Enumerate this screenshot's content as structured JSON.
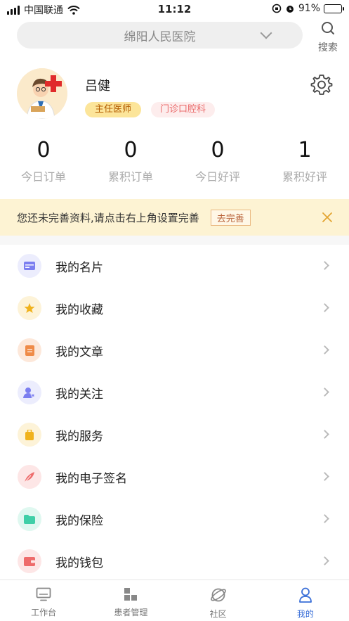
{
  "status_bar": {
    "carrier": "中国联通",
    "time": "11:12",
    "battery": "91%",
    "battery_level": 0.91
  },
  "header": {
    "hospital": "绵阳人民医院",
    "search_label": "搜索"
  },
  "profile": {
    "name": "吕健",
    "title_badge": "主任医师",
    "dept_badge": "门诊口腔科"
  },
  "stats": [
    {
      "value": "0",
      "label": "今日订单"
    },
    {
      "value": "0",
      "label": "累积订单"
    },
    {
      "value": "0",
      "label": "今日好评"
    },
    {
      "value": "1",
      "label": "累积好评"
    }
  ],
  "notice": {
    "text": "您还未完善资料,请点击右上角设置完善",
    "action": "去完善"
  },
  "menu": [
    {
      "label": "我的名片",
      "icon": "card-icon",
      "color": "#7b7ef0",
      "bg": "#ecedfd"
    },
    {
      "label": "我的收藏",
      "icon": "star-icon",
      "color": "#f0b21c",
      "bg": "#fdf3d8"
    },
    {
      "label": "我的文章",
      "icon": "article-icon",
      "color": "#ef8b48",
      "bg": "#fde8da"
    },
    {
      "label": "我的关注",
      "icon": "follow-user-icon",
      "color": "#7b7ef0",
      "bg": "#ecedfd"
    },
    {
      "label": "我的服务",
      "icon": "service-bag-icon",
      "color": "#f0b21c",
      "bg": "#fdf3d8"
    },
    {
      "label": "我的电子签名",
      "icon": "feather-pen-icon",
      "color": "#ee6b6b",
      "bg": "#fde6e6"
    },
    {
      "label": "我的保险",
      "icon": "folder-icon",
      "color": "#3fcfa7",
      "bg": "#dff8f0"
    },
    {
      "label": "我的钱包",
      "icon": "wallet-icon",
      "color": "#ee6b6b",
      "bg": "#fde6e6"
    }
  ],
  "tabs": [
    {
      "label": "工作台",
      "icon": "monitor-icon"
    },
    {
      "label": "患者管理",
      "icon": "grid-blocks-icon"
    },
    {
      "label": "社区",
      "icon": "planet-icon"
    },
    {
      "label": "我的",
      "icon": "person-icon",
      "active": true
    }
  ]
}
